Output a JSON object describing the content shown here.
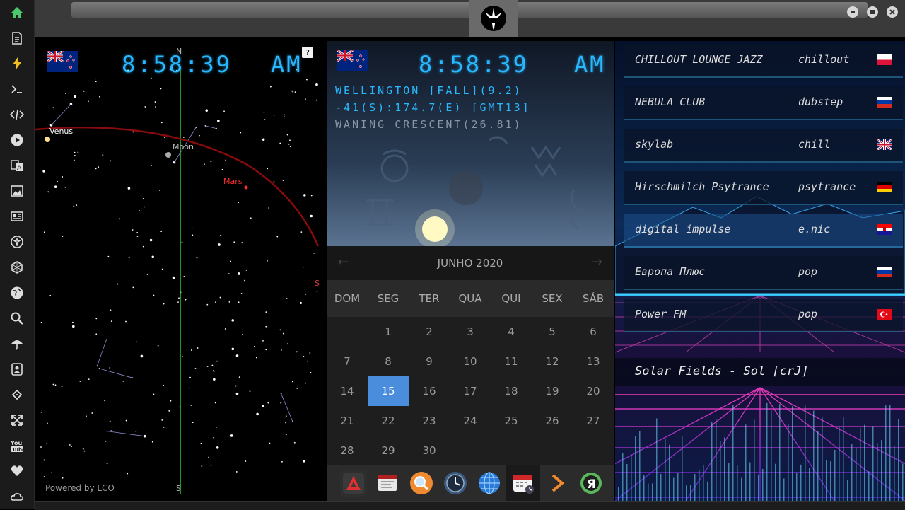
{
  "rail": {
    "icons": [
      "home-icon",
      "document-icon",
      "bolt-icon",
      "terminal-icon",
      "code-icon",
      "play-icon",
      "translate-icon",
      "image-icon",
      "news-icon",
      "rebel-icon",
      "hexagon-icon",
      "globe-icon",
      "search-icon",
      "umbrella-icon",
      "contact-icon",
      "link-icon",
      "expand-icon",
      "youtube-icon",
      "heart-icon",
      "cloud-icon"
    ]
  },
  "window": {
    "controls": [
      "minimize",
      "maximize",
      "close"
    ]
  },
  "sky": {
    "time": "8:58:39",
    "ampm": "AM",
    "help": "?",
    "north": "N",
    "south": "S",
    "east": "S",
    "planets": [
      {
        "name": "Venus",
        "color": "#ffffff"
      },
      {
        "name": "Moon",
        "color": "#bbbbbb"
      },
      {
        "name": "Mars",
        "color": "#ff3030"
      }
    ],
    "powered": "Powered by LCO"
  },
  "moon": {
    "time": "8:58:39",
    "ampm": "AM",
    "line1": "WELLINGTON [FALL](9.2)",
    "line2": "-41(S):174.7(E) [GMT13]",
    "line3": "WANING CRESCENT(26.81)"
  },
  "calendar": {
    "month": "JUNHO 2020",
    "prev": "←",
    "next": "→",
    "weekdays": [
      "DOM",
      "SEG",
      "TER",
      "QUA",
      "QUI",
      "SEX",
      "SÁB"
    ],
    "weeks": [
      [
        "",
        "1",
        "2",
        "3",
        "4",
        "5",
        "6"
      ],
      [
        "7",
        "8",
        "9",
        "10",
        "11",
        "12",
        "13"
      ],
      [
        "14",
        "15",
        "16",
        "17",
        "18",
        "19",
        "20"
      ],
      [
        "21",
        "22",
        "23",
        "24",
        "25",
        "26",
        "27"
      ],
      [
        "28",
        "29",
        "30",
        "",
        "",
        "",
        ""
      ]
    ],
    "selected": "15"
  },
  "dock": {
    "apps": [
      "app-a-icon",
      "notes-icon",
      "search-app-icon",
      "clock-app-icon",
      "globe-app-icon",
      "calendar-app-icon",
      "next-app-icon",
      "yandex-icon"
    ]
  },
  "radio": {
    "stations": [
      {
        "name": "CHILLOUT LOUNGE JAZZ",
        "genre": "chillout",
        "flag": "poland"
      },
      {
        "name": "NEBULA CLUB",
        "genre": "dubstep",
        "flag": "russia"
      },
      {
        "name": "skylab",
        "genre": "chill",
        "flag": "uk"
      },
      {
        "name": "Hirschmilch Psytrance",
        "genre": "psytrance",
        "flag": "germany"
      },
      {
        "name": "digital impulse",
        "genre": "e.nic",
        "flag": "croatia"
      },
      {
        "name": "Европа Плюс",
        "genre": "pop",
        "flag": "russia"
      },
      {
        "name": "Power FM",
        "genre": "pop",
        "flag": "turkey"
      }
    ],
    "now_playing": "Solar Fields - Sol [crJ]"
  }
}
